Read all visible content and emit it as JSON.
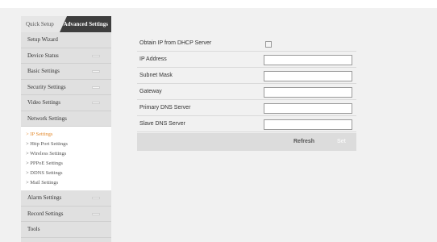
{
  "tabs": {
    "quick_setup": "Quick Setup",
    "advanced_settings": "Advanced Settings"
  },
  "sidebar": {
    "items_top": [
      {
        "label": "Setup Wizard",
        "indicator": false
      },
      {
        "label": "Device Status",
        "indicator": true
      },
      {
        "label": "Basic Settings",
        "indicator": true
      },
      {
        "label": "Security Settings",
        "indicator": true
      },
      {
        "label": "Video Settings",
        "indicator": true
      },
      {
        "label": "Network Settings",
        "indicator": false
      }
    ],
    "network_submenu": [
      {
        "label": "> IP Settings",
        "active": true
      },
      {
        "label": "> Http Port Settings",
        "active": false
      },
      {
        "label": "> Wireless Settings",
        "active": false
      },
      {
        "label": "> PPPoE Settings",
        "active": false
      },
      {
        "label": "> DDNS Settings",
        "active": false
      },
      {
        "label": "> Mail Settings",
        "active": false
      }
    ],
    "items_bottom": [
      {
        "label": "Alarm Settings",
        "indicator": true
      },
      {
        "label": "Record Settings",
        "indicator": true
      },
      {
        "label": "Tools",
        "indicator": false
      }
    ]
  },
  "form": {
    "dhcp_label": "Obtain IP from DHCP Server",
    "dhcp_checked": false,
    "fields": [
      {
        "label": "IP Address",
        "value": ""
      },
      {
        "label": "Subnet Mask",
        "value": ""
      },
      {
        "label": "Gateway",
        "value": ""
      },
      {
        "label": "Primary DNS Server",
        "value": ""
      },
      {
        "label": "Slave DNS Server",
        "value": ""
      }
    ]
  },
  "actions": {
    "refresh": "Refresh",
    "set": "Set"
  },
  "colors": {
    "active_submenu": "#e38a2e",
    "tab_active_bg": "#3e3e3e",
    "sidebar_bg": "#e0e0e0"
  }
}
